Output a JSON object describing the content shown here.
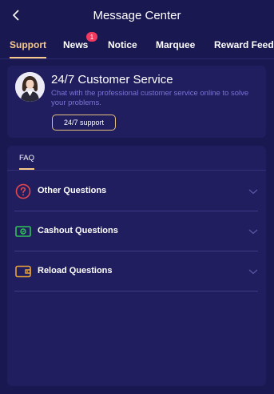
{
  "header": {
    "title": "Message Center",
    "back_icon": "chevron-left-icon"
  },
  "tabs": [
    {
      "label": "Support",
      "active": true
    },
    {
      "label": "News",
      "badge": "1"
    },
    {
      "label": "Notice"
    },
    {
      "label": "Marquee"
    },
    {
      "label": "Reward Feedb"
    }
  ],
  "customer_service": {
    "title": "24/7 Customer Service",
    "description": "Chat with the professional customer service online to solve your problems.",
    "button_label": "24/7 support",
    "avatar_icon": "agent-avatar"
  },
  "faq": {
    "tab_label": "FAQ",
    "items": [
      {
        "label": "Other Questions",
        "icon": "question-circle-icon",
        "icon_color": "#e2474f"
      },
      {
        "label": "Cashout Questions",
        "icon": "cash-icon",
        "icon_color": "#2fc45b"
      },
      {
        "label": "Reload Questions",
        "icon": "wallet-icon",
        "icon_color": "#e9a23b"
      }
    ]
  },
  "colors": {
    "background": "#1a1850",
    "card": "#201e5e",
    "accent": "#f7c98a",
    "badge": "#f03a5f",
    "description_text": "#7c73d8"
  }
}
